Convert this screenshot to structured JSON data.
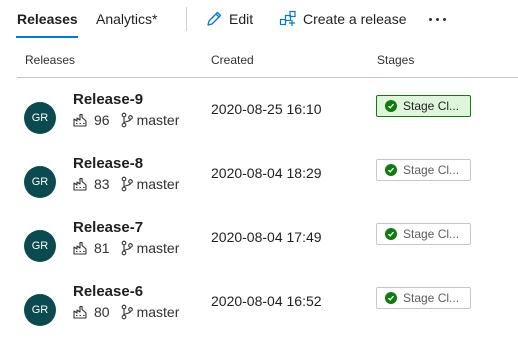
{
  "toolbar": {
    "tabs": [
      "Releases",
      "Analytics*"
    ],
    "edit_label": "Edit",
    "create_label": "Create a release"
  },
  "columns": {
    "releases": "Releases",
    "created": "Created",
    "stages": "Stages"
  },
  "rows": [
    {
      "avatar": "GR",
      "name": "Release-9",
      "build": "96",
      "branch": "master",
      "created": "2020-08-25 16:10",
      "stage": "Stage Cl...",
      "stage_active": true
    },
    {
      "avatar": "GR",
      "name": "Release-8",
      "build": "83",
      "branch": "master",
      "created": "2020-08-04 18:29",
      "stage": "Stage Cl...",
      "stage_active": false
    },
    {
      "avatar": "GR",
      "name": "Release-7",
      "build": "81",
      "branch": "master",
      "created": "2020-08-04 17:49",
      "stage": "Stage Cl...",
      "stage_active": false
    },
    {
      "avatar": "GR",
      "name": "Release-6",
      "build": "80",
      "branch": "master",
      "created": "2020-08-04 16:52",
      "stage": "Stage Cl...",
      "stage_active": false
    }
  ],
  "colors": {
    "accent": "#0078d4",
    "avatar": "#0b4a4e",
    "success": "#107c10",
    "active_stage_bg": "#dff6dd"
  },
  "icons": {
    "edit": "pencil-icon",
    "create": "create-release-icon",
    "more": "more-icon",
    "build": "build-icon",
    "branch": "branch-icon",
    "stage_status": "check-circle-icon"
  }
}
